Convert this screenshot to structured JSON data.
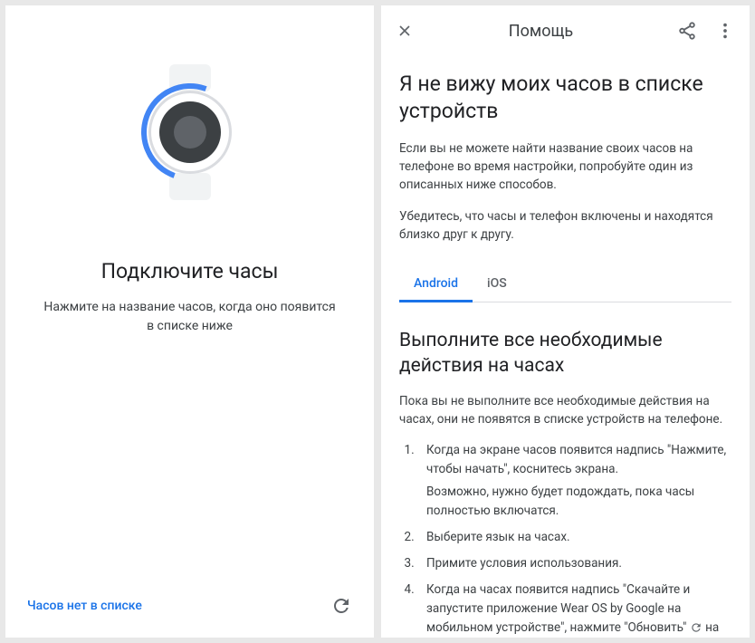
{
  "left": {
    "title": "Подключите часы",
    "subtitle": "Нажмите на название часов, когда оно появится в списке ниже",
    "no_watch_link": "Часов нет в списке"
  },
  "right": {
    "header_title": "Помощь",
    "article_title": "Я не вижу моих часов в списке устройств",
    "intro1": "Если вы не можете найти название своих часов на телефоне во время настройки, попробуйте один из описанных ниже способов.",
    "intro2": "Убедитесь, что часы и телефон включены и находятся близко друг к другу.",
    "tabs": {
      "android": "Android",
      "ios": "iOS"
    },
    "section_title": "Выполните все необходимые действия на часах",
    "section_intro": "Пока вы не выполните все необходимые действия на часах, они не появятся в списке устройств на телефоне.",
    "steps": {
      "s1": "Когда на экране часов появится надпись \"Нажмите, чтобы начать\", коснитесь экрана.",
      "s1_note": "Возможно, нужно будет подождать, пока часы полностью включатся.",
      "s2": "Выберите язык на часах.",
      "s3": "Примите условия использования.",
      "s4a": "Когда на часах появится надпись \"Скачайте и запустите приложение Wear OS by Google на мобильном устройстве\", нажмите \"Обновить\" ",
      "s4b": " на"
    }
  }
}
